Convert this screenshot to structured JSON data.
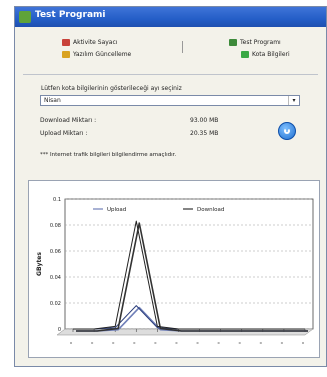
{
  "window": {
    "title": "Test Programi"
  },
  "toolbar": {
    "aktivite": "Aktivite Sayacı",
    "yazilim": "Yazılım Güncelleme",
    "test": "Test Programı",
    "kota": "Kota Bilgileri"
  },
  "form": {
    "prompt": "Lütfen kota bilgilerinin gösterileceği ayı seçiniz",
    "month": "Nisan",
    "download_label": "Download Miktarı :",
    "download_value": "93.00 MB",
    "upload_label": "Upload Miktarı :",
    "upload_value": "20.35 MB",
    "note": "*** Internet trafik bilgileri bilgilendirme amaçlıdır."
  },
  "colors": {
    "upload": "#6f7fb8",
    "download": "#333333"
  },
  "chart_data": {
    "type": "line",
    "ylabel": "GBytes",
    "ylim": [
      0,
      0.1
    ],
    "yticks": [
      "0.1",
      "0.08",
      "0.06",
      "0.04",
      "0.02",
      "0"
    ],
    "x": [
      "",
      "",
      "",
      "",
      "",
      "",
      "",
      "",
      "",
      "",
      "",
      ""
    ],
    "legend": "top",
    "series": [
      {
        "name": "Upload",
        "values": [
          0,
          0,
          0.001,
          0.018,
          0.001,
          0,
          0,
          0,
          0,
          0,
          0,
          0
        ]
      },
      {
        "name": "Download",
        "values": [
          0,
          0,
          0.002,
          0.083,
          0.002,
          0,
          0,
          0,
          0,
          0,
          0,
          0
        ]
      }
    ]
  }
}
